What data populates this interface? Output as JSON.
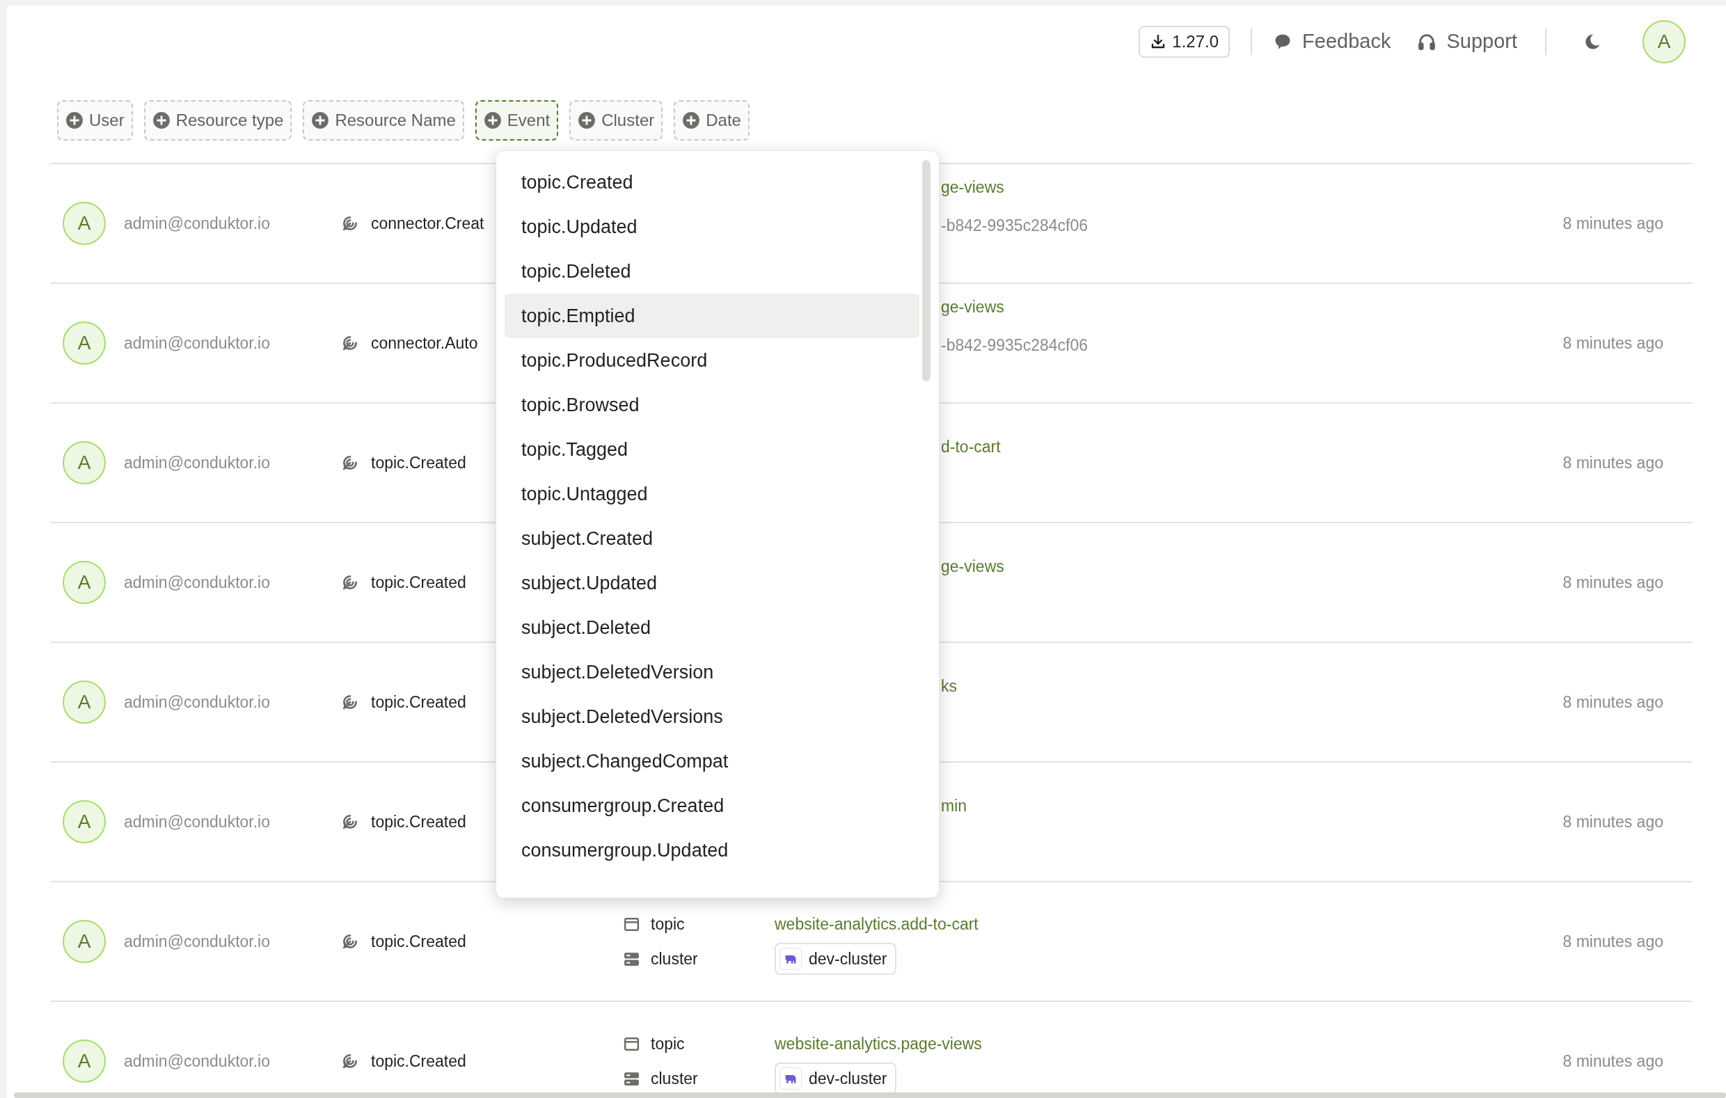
{
  "top_bar": {
    "version_button": "1.27.0",
    "links": [
      {
        "label": "Feedback",
        "kind": "feedback"
      },
      {
        "label": "Support",
        "kind": "support"
      }
    ],
    "avatar": "A"
  },
  "filters": [
    {
      "label": "User",
      "selected": false
    },
    {
      "label": "Resource type",
      "selected": false
    },
    {
      "label": "Resource Name",
      "selected": false
    },
    {
      "label": "Event",
      "selected": true
    },
    {
      "label": "Cluster",
      "selected": false
    },
    {
      "label": "Date",
      "selected": false
    }
  ],
  "event_menu": {
    "items": [
      {
        "label": "topic.Created",
        "selected": false
      },
      {
        "label": "topic.Updated",
        "selected": false
      },
      {
        "label": "topic.Deleted",
        "selected": false
      },
      {
        "label": "topic.Emptied",
        "selected": true
      },
      {
        "label": "topic.ProducedRecord",
        "selected": false
      },
      {
        "label": "topic.Browsed",
        "selected": false
      },
      {
        "label": "topic.Tagged",
        "selected": false
      },
      {
        "label": "topic.Untagged",
        "selected": false
      },
      {
        "label": "subject.Created",
        "selected": false
      },
      {
        "label": "subject.Updated",
        "selected": false
      },
      {
        "label": "subject.Deleted",
        "selected": false
      },
      {
        "label": "subject.DeletedVersion",
        "selected": false
      },
      {
        "label": "subject.DeletedVersions",
        "selected": false
      },
      {
        "label": "subject.ChangedCompat",
        "selected": false
      },
      {
        "label": "consumergroup.Created",
        "selected": false
      },
      {
        "label": "consumergroup.Updated",
        "selected": false
      }
    ]
  },
  "rows": [
    {
      "kind": "partial",
      "avatar": "A",
      "user": "admin@conduktor.io",
      "event": "connector.Creat",
      "fragments": [
        {
          "kind": "link",
          "text": "ge-views"
        },
        {
          "kind": "id",
          "text": "-b842-9935c284cf06"
        }
      ],
      "time": "8 minutes ago"
    },
    {
      "kind": "partial",
      "avatar": "A",
      "user": "admin@conduktor.io",
      "event": "connector.Auto",
      "fragments": [
        {
          "kind": "link",
          "text": "ge-views"
        },
        {
          "kind": "id",
          "text": "-b842-9935c284cf06"
        }
      ],
      "time": "8 minutes ago"
    },
    {
      "kind": "partial",
      "avatar": "A",
      "user": "admin@conduktor.io",
      "event": "topic.Created",
      "fragments": [
        {
          "kind": "link",
          "text": "d-to-cart"
        }
      ],
      "time": "8 minutes ago"
    },
    {
      "kind": "partial",
      "avatar": "A",
      "user": "admin@conduktor.io",
      "event": "topic.Created",
      "fragments": [
        {
          "kind": "link",
          "text": "ge-views"
        }
      ],
      "time": "8 minutes ago"
    },
    {
      "kind": "partial",
      "avatar": "A",
      "user": "admin@conduktor.io",
      "event": "topic.Created",
      "fragments": [
        {
          "kind": "link",
          "text": "ks"
        }
      ],
      "time": "8 minutes ago"
    },
    {
      "kind": "partial",
      "avatar": "A",
      "user": "admin@conduktor.io",
      "event": "topic.Created",
      "fragments": [
        {
          "kind": "link",
          "text": "min"
        }
      ],
      "time": "8 minutes ago"
    },
    {
      "kind": "full",
      "avatar": "A",
      "user": "admin@conduktor.io",
      "event": "topic.Created",
      "resources": [
        {
          "type": "topic",
          "kind": "link",
          "name": "website-analytics.add-to-cart"
        },
        {
          "type": "cluster",
          "kind": "badge",
          "name": "dev-cluster"
        }
      ],
      "time": "8 minutes ago"
    },
    {
      "kind": "full",
      "avatar": "A",
      "user": "admin@conduktor.io",
      "event": "topic.Created",
      "resources": [
        {
          "type": "topic",
          "kind": "link",
          "name": "website-analytics.page-views"
        },
        {
          "type": "cluster",
          "kind": "badge",
          "name": "dev-cluster"
        }
      ],
      "time": "8 minutes ago"
    }
  ]
}
